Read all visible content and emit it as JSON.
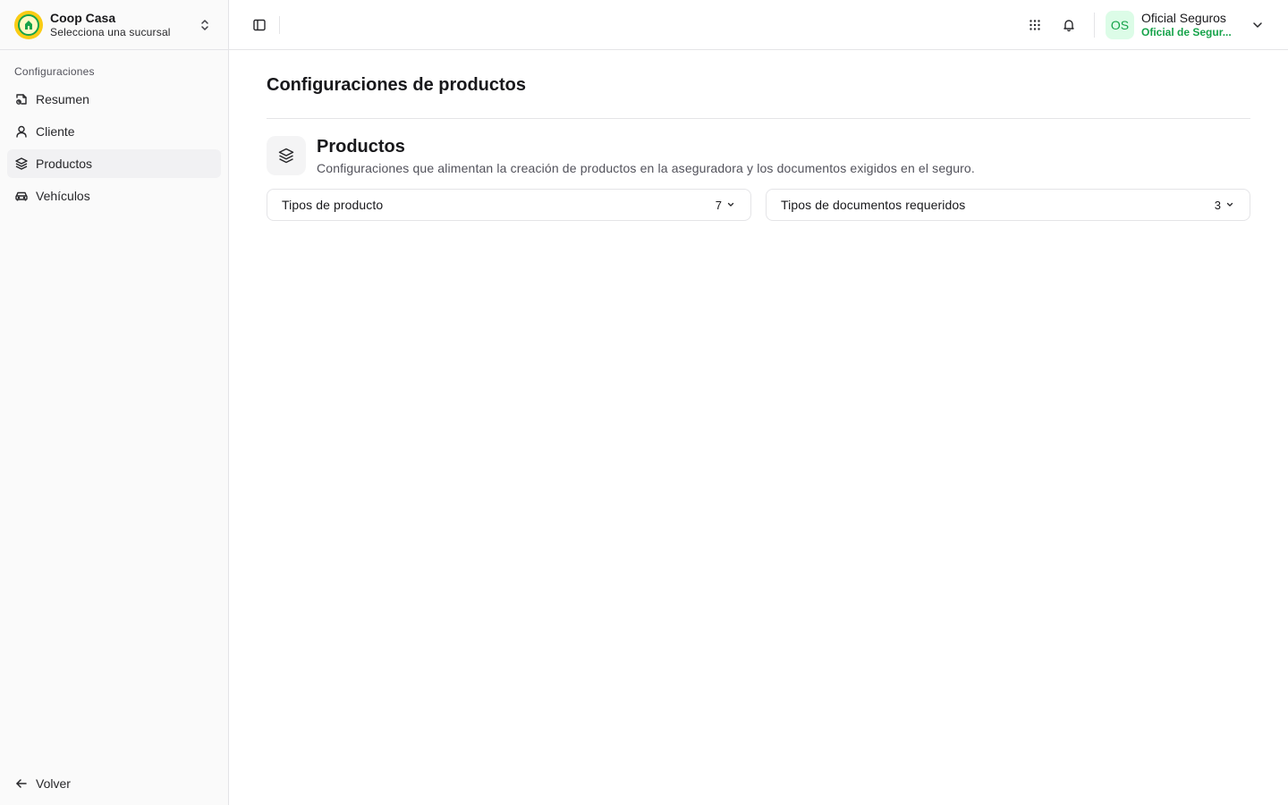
{
  "brand": {
    "name": "Coop Casa",
    "subtitle": "Selecciona una sucursal"
  },
  "sidebar": {
    "section_label": "Configuraciones",
    "items": [
      {
        "label": "Resumen",
        "icon": "summary-icon"
      },
      {
        "label": "Cliente",
        "icon": "user-icon"
      },
      {
        "label": "Productos",
        "icon": "layers-icon",
        "active": true
      },
      {
        "label": "Vehículos",
        "icon": "car-icon"
      }
    ],
    "back_label": "Volver"
  },
  "user": {
    "initials": "OS",
    "name": "Oficial Seguros",
    "role": "Oficial de Segur..."
  },
  "main": {
    "title": "Configuraciones de productos",
    "section": {
      "title": "Productos",
      "description": "Configuraciones que alimentan la creación de productos en la aseguradora y los documentos exigidos en el seguro."
    },
    "cards": [
      {
        "label": "Tipos de producto",
        "count": "7"
      },
      {
        "label": "Tipos de documentos requeridos",
        "count": "3"
      }
    ]
  },
  "colors": {
    "accent_green": "#16a34a",
    "avatar_bg": "#dcfce7",
    "logo_yellow": "#facc15"
  }
}
